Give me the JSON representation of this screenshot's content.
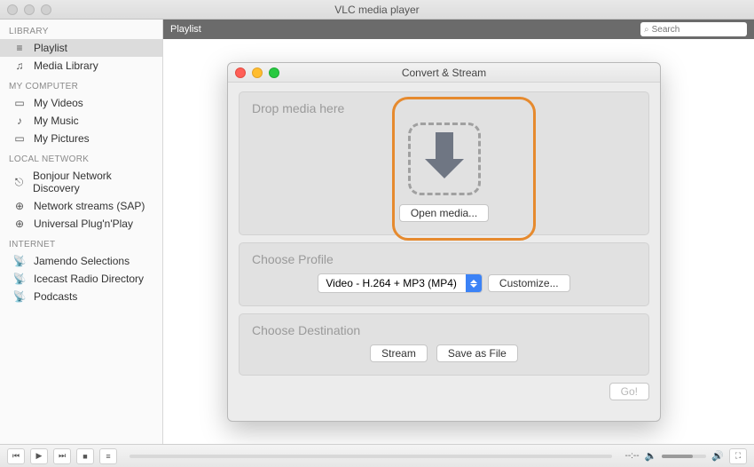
{
  "window": {
    "title": "VLC media player"
  },
  "sidebar": {
    "sections": [
      {
        "header": "LIBRARY",
        "items": [
          {
            "icon": "≡",
            "label": "Playlist",
            "selected": true
          },
          {
            "icon": "♫",
            "label": "Media Library"
          }
        ]
      },
      {
        "header": "MY COMPUTER",
        "items": [
          {
            "icon": "▭",
            "label": "My Videos"
          },
          {
            "icon": "♪",
            "label": "My Music"
          },
          {
            "icon": "▭",
            "label": "My Pictures"
          }
        ]
      },
      {
        "header": "LOCAL NETWORK",
        "items": [
          {
            "icon": "⎋",
            "label": "Bonjour Network Discovery"
          },
          {
            "icon": "⊕",
            "label": "Network streams (SAP)"
          },
          {
            "icon": "⊕",
            "label": "Universal Plug'n'Play"
          }
        ]
      },
      {
        "header": "INTERNET",
        "items": [
          {
            "icon": "📡",
            "label": "Jamendo Selections"
          },
          {
            "icon": "📡",
            "label": "Icecast Radio Directory"
          },
          {
            "icon": "📡",
            "label": "Podcasts"
          }
        ]
      }
    ]
  },
  "topbar": {
    "title": "Playlist",
    "search_placeholder": "Search"
  },
  "dialog": {
    "title": "Convert & Stream",
    "drop_label": "Drop media here",
    "open_btn": "Open media...",
    "profile_label": "Choose Profile",
    "profile_value": "Video - H.264 + MP3 (MP4)",
    "customize_btn": "Customize...",
    "destination_label": "Choose Destination",
    "stream_btn": "Stream",
    "save_btn": "Save as File",
    "go_btn": "Go!"
  },
  "player": {
    "time": "--:--"
  }
}
